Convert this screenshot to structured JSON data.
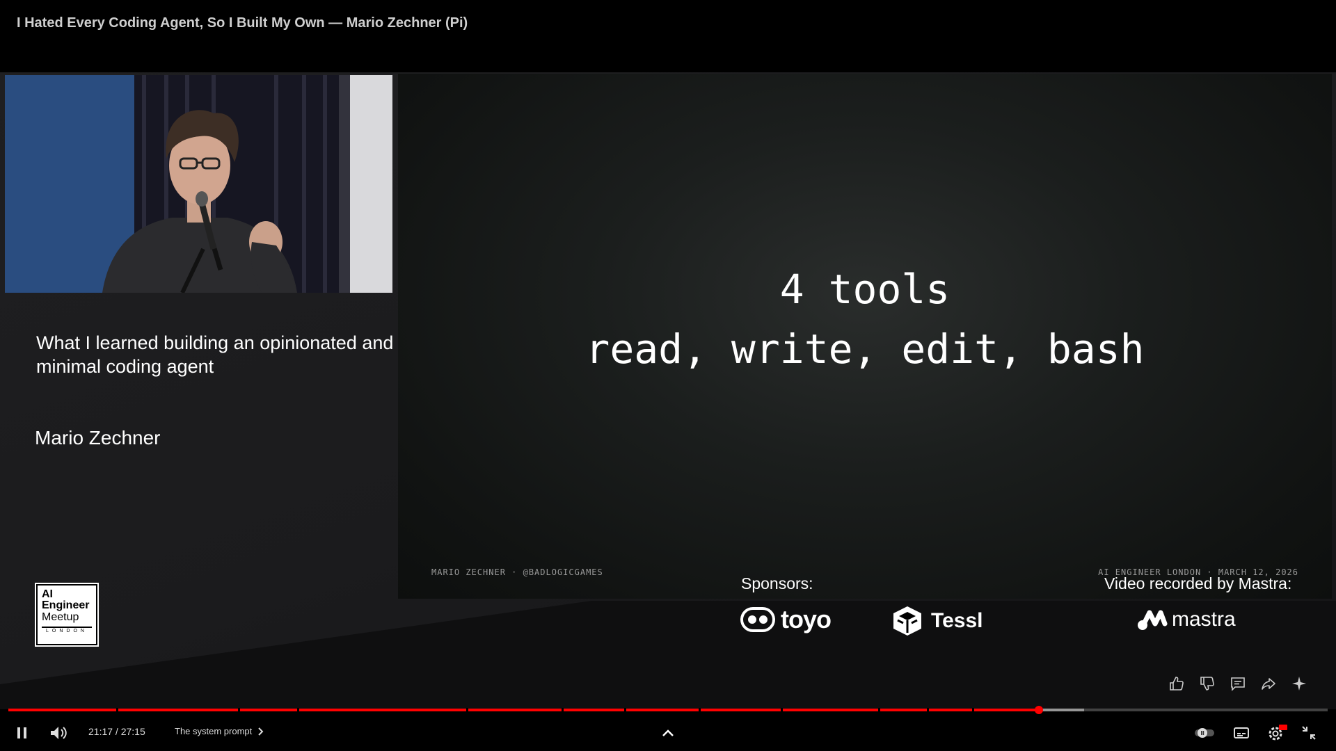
{
  "video": {
    "title": "I Hated Every Coding Agent, So I Built My Own — Mario Zechner (Pi)"
  },
  "left_panel": {
    "talk_subtitle": "What I learned building an opinionated and minimal coding agent",
    "speaker_name": "Mario Zechner"
  },
  "slide": {
    "heading": "4 tools",
    "tools_line": "read, write, edit, bash",
    "footer_left": "MARIO ZECHNER · @BADLOGICGAMES",
    "footer_right": "AI ENGINEER LONDON · MARCH 12, 2026"
  },
  "branding": {
    "sponsors_label": "Sponsors:",
    "recorded_label": "Video recorded by Mastra:",
    "sponsor1": "toyo",
    "sponsor2": "Tessl",
    "recorder": "mastra",
    "meetup_logo": {
      "line1": "AI",
      "line2": "Engineer",
      "line3": "Meetup",
      "line4": "LONDON"
    }
  },
  "player": {
    "current_time": "21:17",
    "duration": "27:15",
    "time_display": "21:17 / 27:15",
    "chapter": "The system prompt",
    "progress_fraction": 0.7809,
    "buffered_fraction": 0.8155,
    "accent_color": "#ff0000",
    "icons": {
      "play_pause": "pause-icon",
      "volume": "volume-icon",
      "chapters_toggle": "chevron-up-icon",
      "autoplay": "autoplay-toggle-icon",
      "captions": "captions-icon",
      "settings": "settings-icon",
      "exit_fullscreen": "exit-fullscreen-icon",
      "like": "thumbs-up-icon",
      "dislike": "thumbs-down-icon",
      "comments": "comment-icon",
      "share": "share-icon",
      "ask": "sparkle-icon"
    },
    "settings_badge": "HD"
  }
}
